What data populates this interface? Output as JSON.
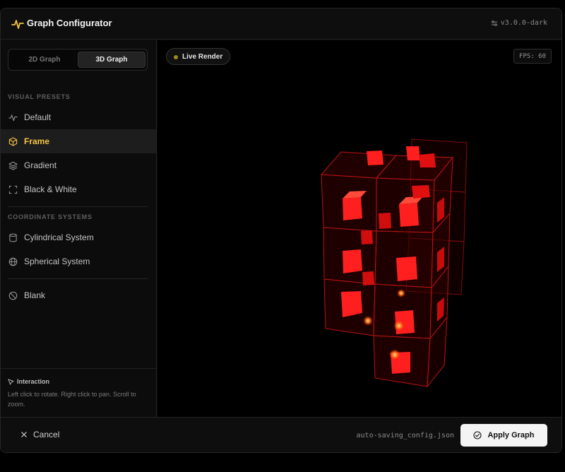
{
  "app": {
    "title": "Graph Configurator",
    "version": "v3.0.0-dark"
  },
  "mode_toggle": {
    "options": [
      "2D Graph",
      "3D Graph"
    ],
    "selected": "3D Graph"
  },
  "sidebar": {
    "sections": [
      {
        "label": "VISUAL PRESETS",
        "items": [
          {
            "label": "Default",
            "icon": "activity-icon",
            "active": false
          },
          {
            "label": "Frame",
            "icon": "cube-icon",
            "active": true
          },
          {
            "label": "Gradient",
            "icon": "layers-icon",
            "active": false
          },
          {
            "label": "Black & White",
            "icon": "frame-corners-icon",
            "active": false
          }
        ]
      },
      {
        "label": "COORDINATE SYSTEMS",
        "items": [
          {
            "label": "Cylindrical System",
            "icon": "cylinder-icon",
            "active": false
          },
          {
            "label": "Spherical System",
            "icon": "globe-icon",
            "active": false
          }
        ]
      }
    ],
    "extra_items": [
      {
        "label": "Blank",
        "icon": "ban-icon",
        "active": false
      }
    ],
    "interaction": {
      "title": "Interaction",
      "text": "Left click to rotate. Right click to pan. Scroll to zoom."
    }
  },
  "viewport": {
    "live_badge": "Live Render",
    "fps": "FPS: 60"
  },
  "footer": {
    "cancel_label": "Cancel",
    "status_file": "auto-saving_config.json",
    "apply_label": "Apply Graph"
  },
  "colors": {
    "accent": "#f5c542",
    "cube_red": "#ff1a1a",
    "background": "#0b0b0b",
    "button_light": "#f4f4f4"
  }
}
